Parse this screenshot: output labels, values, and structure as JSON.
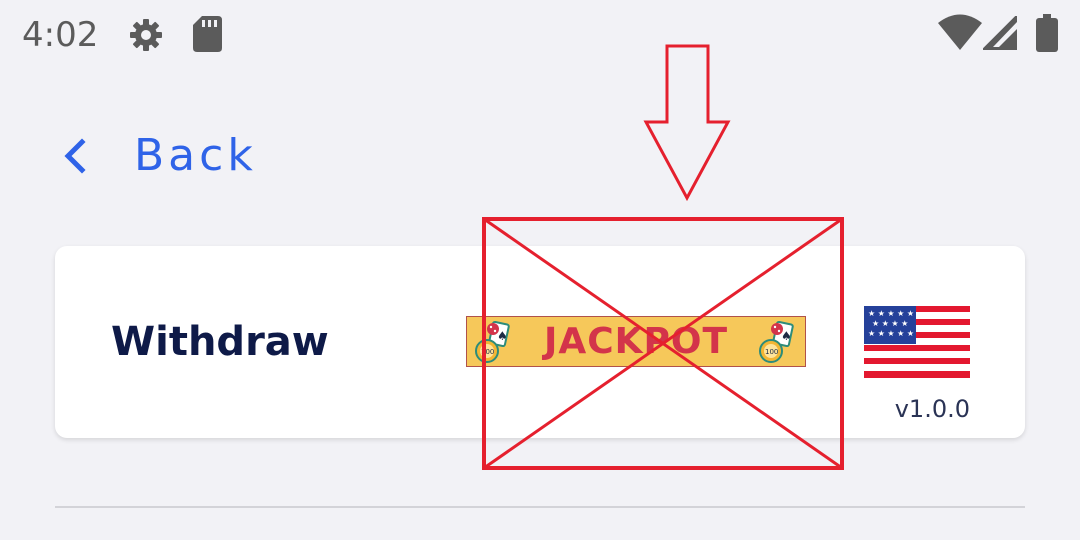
{
  "status_bar": {
    "time": "4:02",
    "icons": [
      "gear-icon",
      "sd-card-icon",
      "wifi-icon",
      "signal-icon",
      "battery-icon"
    ]
  },
  "nav": {
    "back_label": "Back",
    "back_icon": "chevron-left-icon"
  },
  "card": {
    "title": "Withdraw",
    "banner_text": "JACKPOT",
    "flag": "us-flag-icon",
    "version": "v1.0.0"
  },
  "colors": {
    "background": "#f2f2f6",
    "accent": "#2f63e8",
    "title": "#0e1a48",
    "annotation": "#e5202e",
    "banner_bg": "#f6c85a",
    "banner_text": "#d3344a"
  }
}
